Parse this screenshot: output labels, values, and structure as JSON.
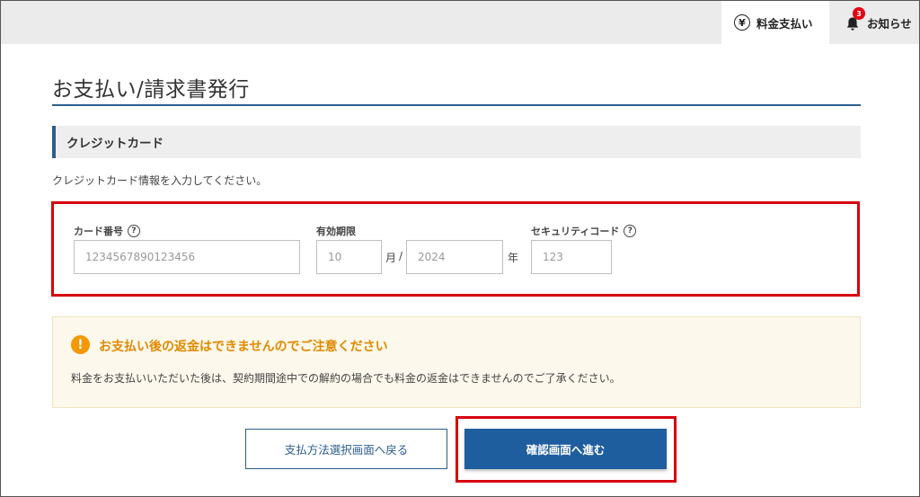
{
  "header": {
    "payment_tab_label": "料金支払い",
    "yen_symbol": "¥",
    "news_tab_label": "お知らせ",
    "notification_count": "3"
  },
  "page": {
    "title": "お支払い/請求書発行"
  },
  "section": {
    "title": "クレジットカード",
    "description": "クレジットカード情報を入力してください。"
  },
  "card_form": {
    "card_number": {
      "label": "カード番号",
      "help": "?",
      "placeholder": "1234567890123456",
      "value": ""
    },
    "expiry": {
      "label": "有効期限",
      "month_placeholder": "10",
      "month_unit": "月",
      "separator": "/",
      "year_placeholder": "2024",
      "year_unit": "年"
    },
    "security_code": {
      "label": "セキュリティコード",
      "help": "?",
      "placeholder": "123",
      "value": ""
    }
  },
  "notice": {
    "icon": "!",
    "title": "お支払い後の返金はできませんのでご注意ください",
    "body": "料金をお支払いいただいた後は、契約期間途中での解約の場合でも料金の返金はできませんのでご了承ください。"
  },
  "actions": {
    "back_label": "支払方法選択画面へ戻る",
    "next_label": "確認画面へ進む"
  },
  "colors": {
    "accent": "#2a5d8f",
    "primary_button": "#1f5e9e",
    "highlight_frame": "#d7000f",
    "warning": "#f39800"
  }
}
